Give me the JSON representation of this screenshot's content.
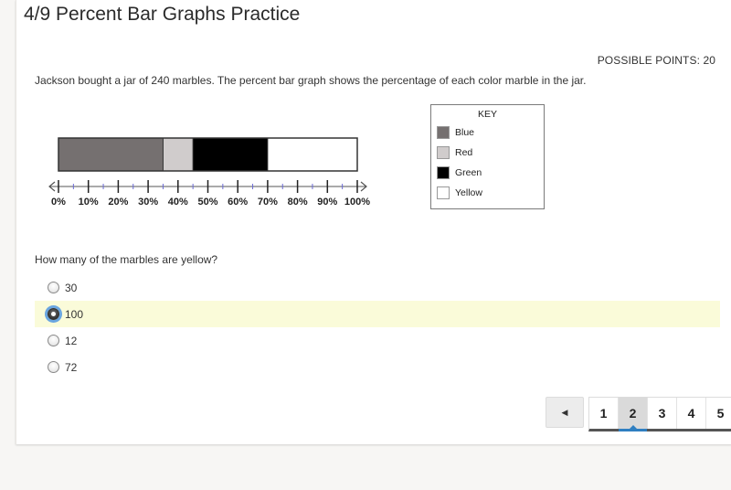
{
  "header": {
    "title": "4/9 Percent Bar Graphs Practice",
    "possible_points": "POSSIBLE POINTS: 20"
  },
  "prompt": "Jackson bought a jar of 240 marbles. The percent bar graph shows the percentage of each color marble in the jar.",
  "chart_data": {
    "type": "bar",
    "orientation": "horizontal-stacked-percent",
    "title": "",
    "categories": [
      "Blue",
      "Red",
      "Green",
      "Yellow"
    ],
    "values": [
      35,
      10,
      25,
      30
    ],
    "colors": [
      "#757070",
      "#d0cccc",
      "#000000",
      "#ffffff"
    ],
    "axis": {
      "ticks": [
        "0%",
        "10%",
        "20%",
        "30%",
        "40%",
        "50%",
        "60%",
        "70%",
        "80%",
        "90%",
        "100%"
      ],
      "range": [
        0,
        100
      ],
      "minor_step": 5
    },
    "legend": {
      "title": "KEY",
      "placement": "right",
      "items": [
        "Blue",
        "Red",
        "Green",
        "Yellow"
      ]
    }
  },
  "question": {
    "text": "How many of the marbles are yellow?",
    "options": [
      {
        "label": "30",
        "selected": false
      },
      {
        "label": "100",
        "selected": true
      },
      {
        "label": "12",
        "selected": false
      },
      {
        "label": "72",
        "selected": false
      }
    ]
  },
  "pagination": {
    "prev_icon": "◀",
    "pages": [
      "1",
      "2",
      "3",
      "4",
      "5"
    ],
    "current": "2"
  }
}
